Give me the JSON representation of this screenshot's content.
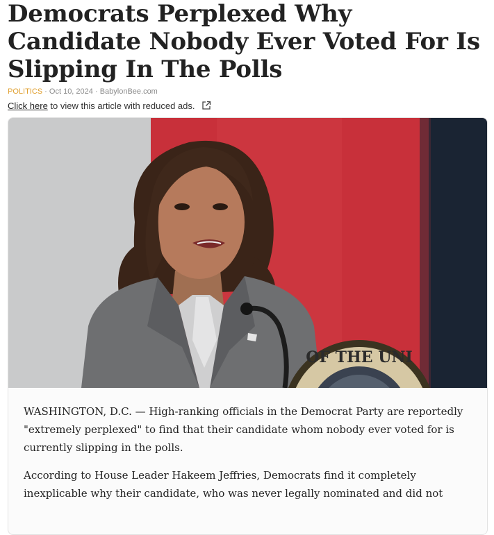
{
  "article": {
    "headline": "Democrats Perplexed Why Candidate Nobody Ever Voted For Is Slipping In The Polls",
    "category": "POLITICS",
    "separator": " · ",
    "date": "Oct 10, 2024",
    "source": "BabylonBee.com",
    "reduced_ads_link": "Click here",
    "reduced_ads_text": " to view this article with reduced ads.",
    "image_icon": "photo",
    "seal_text": "OF THE UNI",
    "paragraphs": [
      "WASHINGTON, D.C. — High-ranking officials in the Democrat Party are reportedly \"extremely perplexed\" to find that their candidate whom nobody ever voted for is currently slipping in the polls.",
      "According to House Leader Hakeem Jeffries, Democrats find it completely inexplicable why their candidate, who was never legally nominated and did not"
    ]
  },
  "colors": {
    "category": "#e0a030",
    "meta": "#8a8a8a",
    "backdrop_red": "#c8303a",
    "backdrop_grey": "#c9cacb",
    "backdrop_navy": "#1a2433",
    "suit": "#6e6f71"
  }
}
